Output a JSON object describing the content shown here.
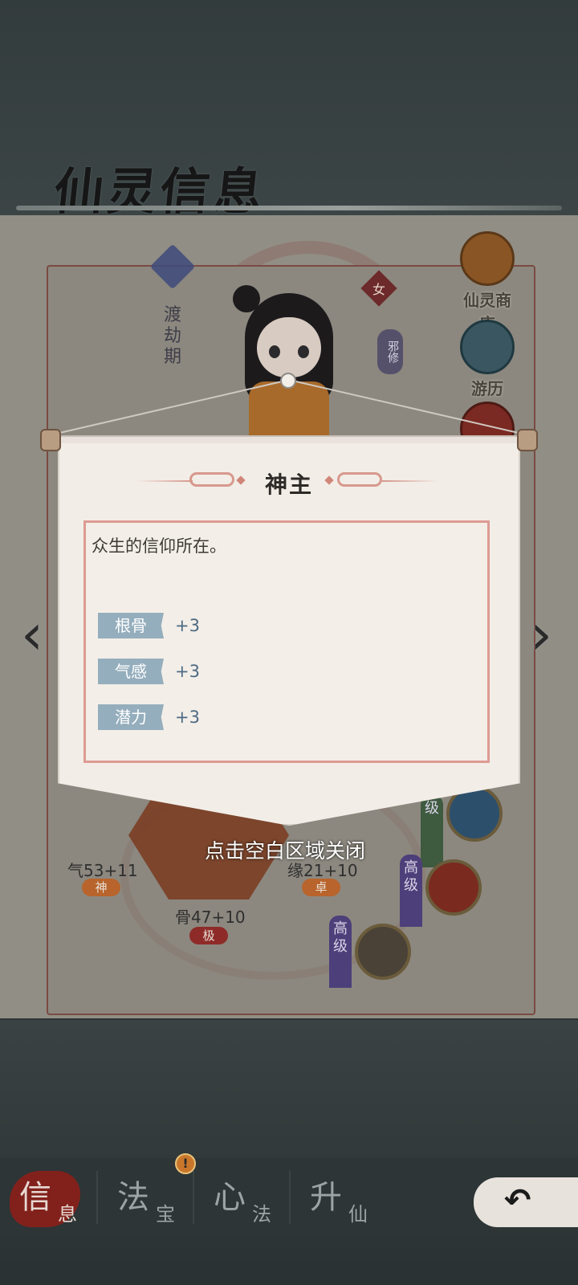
{
  "page_title": "仙灵信息",
  "character": {
    "realm": "渡劫期",
    "gender": "女",
    "alignment": "邪修"
  },
  "side_menu": [
    {
      "label": "仙灵商店",
      "icon": "shop-icon"
    },
    {
      "label": "游历",
      "icon": "travel-icon"
    },
    {
      "label": "",
      "icon": "spider-icon"
    }
  ],
  "stats": {
    "qi": {
      "value": "气53+11",
      "tag": "神"
    },
    "yuan": {
      "value": "缘21+10",
      "tag": "卓"
    },
    "gu": {
      "value": "骨47+10",
      "tag": "极"
    }
  },
  "skills": [
    {
      "grade": "级",
      "icon": "water-vortex-icon"
    },
    {
      "grade": "高级",
      "icon": "fire-icon"
    },
    {
      "grade": "高级",
      "icon": "mountain-icon"
    }
  ],
  "dialog": {
    "title": "神主",
    "description": "众生的信仰所在。",
    "attributes": [
      {
        "name": "根骨",
        "value": "+3"
      },
      {
        "name": "气感",
        "value": "+3"
      },
      {
        "name": "潜力",
        "value": "+3"
      }
    ],
    "close_hint": "点击空白区域关闭"
  },
  "bottom_nav": [
    {
      "big": "信",
      "small": "息",
      "active": true
    },
    {
      "big": "法",
      "small": "宝",
      "active": false,
      "badge": "!"
    },
    {
      "big": "心",
      "small": "法",
      "active": false
    },
    {
      "big": "升",
      "small": "仙",
      "active": false
    }
  ],
  "back_button": {
    "icon": "back-arrow-icon"
  },
  "colors": {
    "overlay": "#2c3436",
    "paper": "#f2ede7",
    "frame": "#dd9b93",
    "attr_tag": "#95aebd",
    "attr_value": "#4d6a83",
    "active_nav": "#8c1f1a"
  }
}
